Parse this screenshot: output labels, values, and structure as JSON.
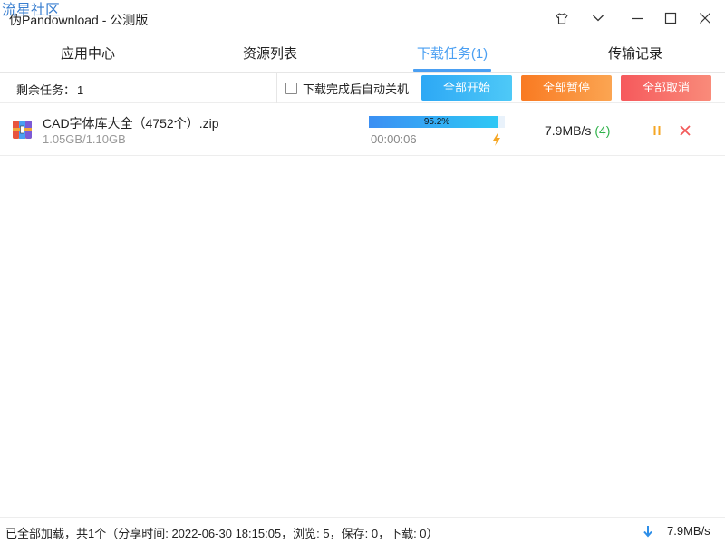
{
  "watermark": "流星社区",
  "window": {
    "title": "伪Pandownload - 公测版"
  },
  "tabs": [
    {
      "label": "应用中心",
      "active": false
    },
    {
      "label": "资源列表",
      "active": false
    },
    {
      "label": "下载任务(1)",
      "active": true
    },
    {
      "label": "传输记录",
      "active": false
    }
  ],
  "toolbar": {
    "remaining_label": "剩余任务：",
    "remaining_count": "1",
    "shutdown_label": "下载完成后自动关机",
    "shutdown_checked": false,
    "start_all": "全部开始",
    "pause_all": "全部暂停",
    "cancel_all": "全部取消"
  },
  "tasks": [
    {
      "name": "CAD字体库大全（4752个）.zip",
      "size": "1.05GB/1.10GB",
      "progress_text": "95.2%",
      "progress": 0.952,
      "elapsed": "00:00:06",
      "speed": "7.9MB/s",
      "connections": "(4)"
    }
  ],
  "status": {
    "text": "已全部加载，共1个（分享时间: 2022-06-30 18:15:05，浏览: 5，保存: 0，下载: 0）",
    "total_speed": "7.9MB/s"
  },
  "colors": {
    "accent": "#4a9ff2",
    "start": "#2da8f5",
    "pause": "#f97a22",
    "cancel": "#f6595c",
    "connections": "#2fb24a"
  },
  "icons": [
    "tshirt-icon",
    "chevron-down-icon",
    "minimize-icon",
    "maximize-icon",
    "close-icon",
    "archive-icon",
    "bolt-icon",
    "pause-icon",
    "cancel-icon",
    "download-arrow-icon"
  ]
}
